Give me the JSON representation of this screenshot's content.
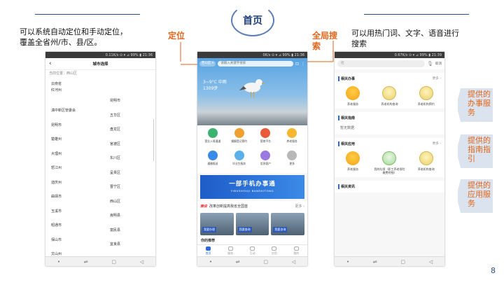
{
  "slide": {
    "title": "首页",
    "left_desc": "可以系统自动定位和手动定位，\n覆盖全省州/市、县/区。",
    "right_desc": "可以用热门词、文字、语音进行\n搜索",
    "callout_locate": "定位",
    "callout_search": "全局搜\n索",
    "page_number": "8",
    "arrow1": "提供的\n办事服\n务",
    "arrow2": "提供的\n指南指\n引",
    "arrow3": "提供的\n应用服\n务"
  },
  "colors": {
    "accent": "#e2661b",
    "brand_blue": "#2d6ad8",
    "title_blue": "#1f3f7a"
  },
  "phone1": {
    "status": "0.11K/s ⊙ ▾ ⊿ 99% ▮ 21:36",
    "back": "‹",
    "title": "城市选择",
    "current": "当前位置：西山区",
    "left_col": [
      "云南省",
      "红河州",
      "滇中新区管委会",
      "昆明市",
      "楚雄州",
      "大理州",
      "怒江州",
      "迪庆州",
      "曲靖市",
      "玉溪市",
      "昭通市",
      "保山市",
      "文山州"
    ],
    "right_col": [
      "昆明市",
      "五华区",
      "盘龙区",
      "官渡区",
      "东川区",
      "呈贡区",
      "晋宁区",
      "西山区",
      "嵩明县",
      "富民县",
      "宜良县"
    ]
  },
  "phone2": {
    "status": "0K/s ⊙ ▾ ⊿ 99% ▮ 21:36",
    "location": "西山区 ▾",
    "search_placeholder": "请输入关键字搜索",
    "weather": "3~9°C 中雨",
    "aqi": "1309步",
    "services": [
      "营业入境通道",
      "婚姻登记预约",
      "营商平台",
      "养老服务",
      "通缴报送",
      "毕业生服务",
      "信息客户",
      "更多"
    ],
    "banner_title": "一部手机办事通",
    "banner_sub": "YIBUSHOUJI BANSHITONG",
    "news_tag": "微说",
    "news_text": "改革创新提高我省全国首",
    "news_more": "更多 ›",
    "cards": [
      "我要办理",
      "我要查询",
      "我要咨询"
    ],
    "section_title": "你的推荐",
    "tabs": [
      "首页",
      "服务",
      "互动",
      "应用",
      "我的"
    ]
  },
  "phone3": {
    "status": "0.67K/s ⊙ ▾ ⊿ 99% ▮ 21:39",
    "search_value": "社",
    "cancel": "取消",
    "sec1_title": "相关办事",
    "sec1_more": "更多 ›",
    "sec1_items": [
      "养老服务",
      "养老机构查询",
      "养老机构预约"
    ],
    "sec2_title": "相关指南",
    "sec2_empty": "暂无数据",
    "sec3_title": "相关应用",
    "sec3_more": "更多 ›",
    "sec3_items": [
      "养老服务",
      "我的社保（职工养老保险缴费明细）",
      "养老机构查询"
    ],
    "sec4_title": "相关资讯"
  },
  "nav_icons": [
    "dot-icon",
    "return-icon",
    "square-icon",
    "back-triangle-icon"
  ]
}
